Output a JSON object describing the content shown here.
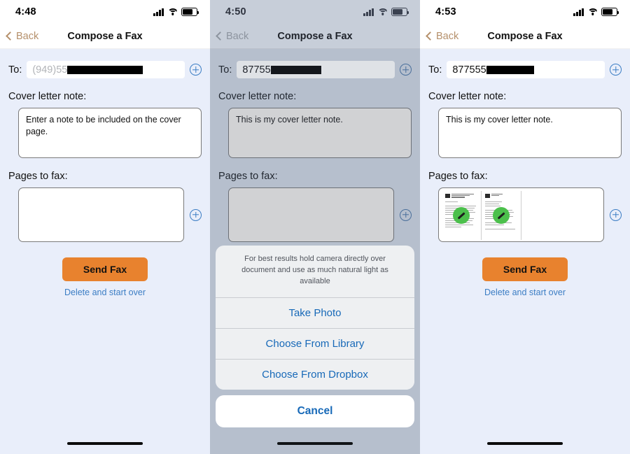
{
  "colors": {
    "accent_send": "#e8822e",
    "link_blue": "#3b7dc4",
    "sheet_blue": "#1769b8",
    "back_tan": "#b5906b",
    "badge_green": "#4cc04c",
    "panel_bg": "#e9eefa",
    "dimmed_bg": "#b6bfcd"
  },
  "panels": [
    {
      "id": "empty-form",
      "status": {
        "time": "4:48",
        "signal": "cellular-signal-icon",
        "wifi": "wifi-icon",
        "battery": "battery-icon"
      },
      "nav": {
        "back": "Back",
        "title": "Compose a Fax"
      },
      "to": {
        "label": "To:",
        "placeholder": "(949)55",
        "value": "",
        "redacted": true,
        "add": "add-recipient-icon"
      },
      "cover": {
        "label": "Cover letter note:",
        "value": "",
        "placeholder": "Enter a note to be included on the cover page."
      },
      "pages": {
        "label": "Pages to fax:",
        "thumbnails": [],
        "add": "add-page-icon"
      },
      "actions": {
        "send": "Send Fax",
        "delete": "Delete and start over"
      },
      "sheet": null
    },
    {
      "id": "action-sheet",
      "status": {
        "time": "4:50",
        "signal": "cellular-signal-icon",
        "wifi": "wifi-icon",
        "battery": "battery-icon"
      },
      "nav": {
        "back": "Back",
        "title": "Compose a Fax"
      },
      "to": {
        "label": "To:",
        "placeholder": "",
        "value": "87755",
        "redacted": true,
        "add": "add-recipient-icon"
      },
      "cover": {
        "label": "Cover letter note:",
        "value": "This is my cover letter note.",
        "placeholder": ""
      },
      "pages": {
        "label": "Pages to fax:",
        "thumbnails": [],
        "add": "add-page-icon"
      },
      "actions": {
        "send": "",
        "delete": ""
      },
      "sheet": {
        "message": "For best results hold camera directly over document and use as much natural light as available",
        "options": [
          "Take Photo",
          "Choose From Library",
          "Choose From Dropbox"
        ],
        "cancel": "Cancel"
      }
    },
    {
      "id": "pages-attached",
      "status": {
        "time": "4:53",
        "signal": "cellular-signal-icon",
        "wifi": "wifi-icon",
        "battery": "battery-icon"
      },
      "nav": {
        "back": "Back",
        "title": "Compose a Fax"
      },
      "to": {
        "label": "To:",
        "placeholder": "",
        "value": "877555",
        "redacted": true,
        "add": "add-recipient-icon"
      },
      "cover": {
        "label": "Cover letter note:",
        "value": "This is my cover letter note.",
        "placeholder": ""
      },
      "pages": {
        "label": "Pages to fax:",
        "thumbnails": [
          "scanned-page-1",
          "scanned-page-2"
        ],
        "add": "add-page-icon"
      },
      "actions": {
        "send": "Send Fax",
        "delete": "Delete and start over"
      },
      "sheet": null
    }
  ]
}
